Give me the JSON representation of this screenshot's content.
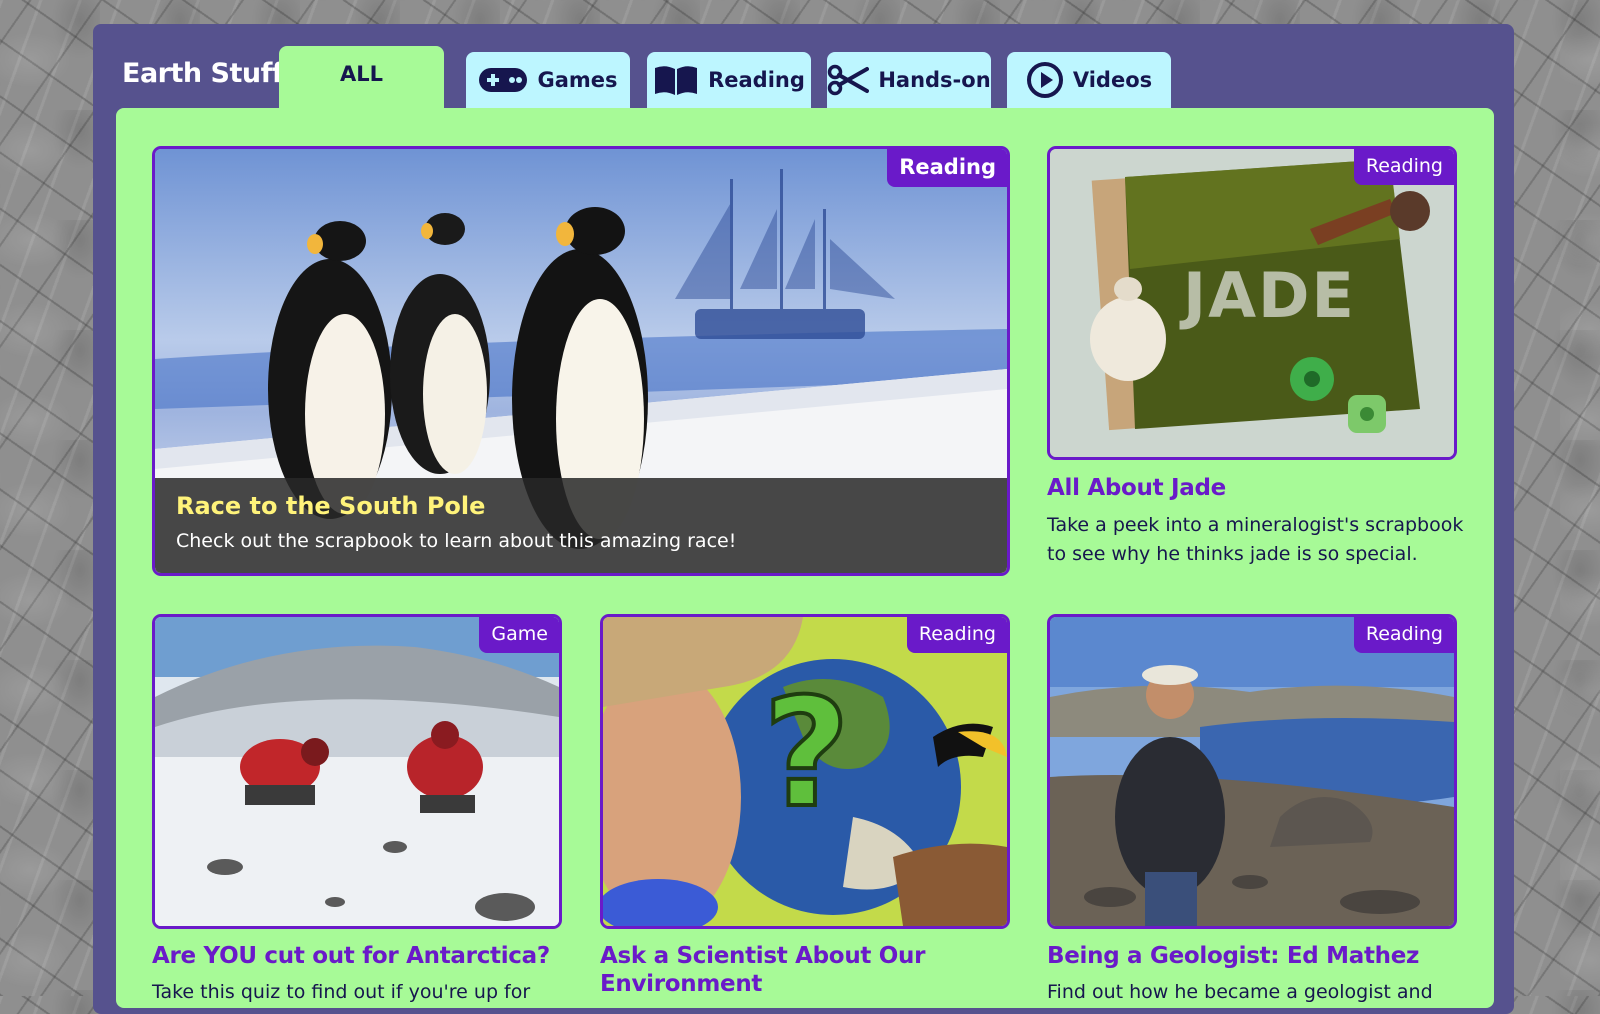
{
  "brand": "Earth Stuff:",
  "tabs": [
    {
      "label": "ALL",
      "icon": "none"
    },
    {
      "label": "Games",
      "icon": "gamepad-icon"
    },
    {
      "label": "Reading",
      "icon": "book-icon"
    },
    {
      "label": "Hands-on",
      "icon": "scissors-icon"
    },
    {
      "label": "Videos",
      "icon": "play-icon"
    }
  ],
  "featured": {
    "badge": "Reading",
    "title": "Race to the South Pole",
    "description": "Check out the scrapbook to learn about this amazing race!"
  },
  "cards": [
    {
      "badge": "Reading",
      "title": "All About Jade",
      "description_lines": [
        "Take a peek into a mineralogist's scrapbook",
        "to see why he thinks jade is so special."
      ],
      "image_text": "JADE"
    },
    {
      "badge": "Game",
      "title": "Are YOU cut out for Antarctica?",
      "description": "Take this quiz to find out if you're up for"
    },
    {
      "badge": "Reading",
      "title_lines": [
        "Ask a Scientist About Our",
        "Environment"
      ],
      "image_text": "?"
    },
    {
      "badge": "Reading",
      "title": "Being a Geologist: Ed Mathez",
      "description": "Find out how he became a geologist and"
    }
  ],
  "colors": {
    "accent": "#6a1ac9",
    "panel": "#a7fa97",
    "tab": "#bdf6ff",
    "frame": "#56528e",
    "featured_title": "#fff37a"
  }
}
